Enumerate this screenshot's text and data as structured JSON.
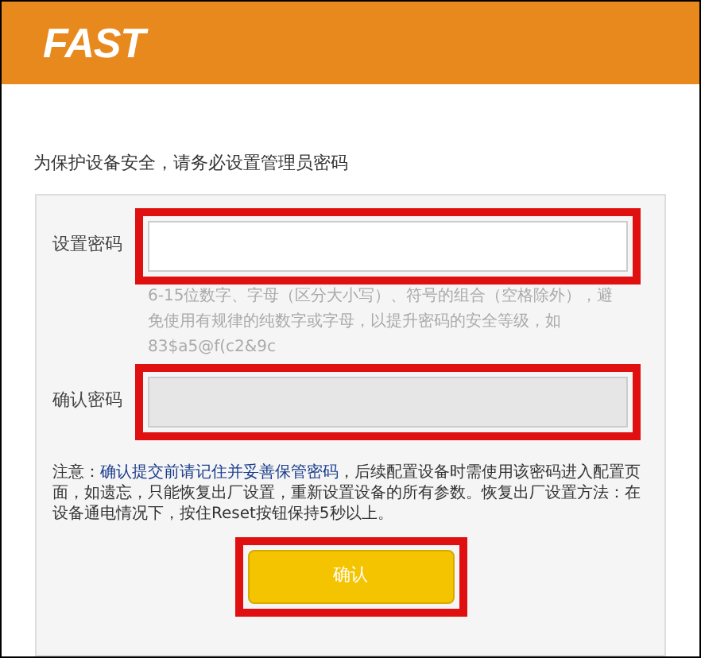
{
  "header": {
    "logo": "FAST"
  },
  "intro": "为保护设备安全，请务必设置管理员密码",
  "fields": [
    {
      "label": "设置密码",
      "disabled": false,
      "highlighted": true,
      "hint": "6-15位数字、字母（区分大小写）、符号的组合（空格除外），避免使用有规律的纯数字或字母，以提升密码的安全等级，如83$a5@f(c2&9c"
    },
    {
      "label": "确认密码",
      "disabled": true,
      "highlighted": true
    }
  ],
  "note": "注意：**确认提交前请记住并妥善保管密码**，后续配置设备时需使用该密码进入配置页面，如遗忘，只能恢复出厂设置，重新设置设备的所有参数。恢复出厂设置方法：在设备通电情况下，按住Reset按钮保持5秒以上。",
  "button": {
    "label": "确认",
    "highlighted": true
  }
}
